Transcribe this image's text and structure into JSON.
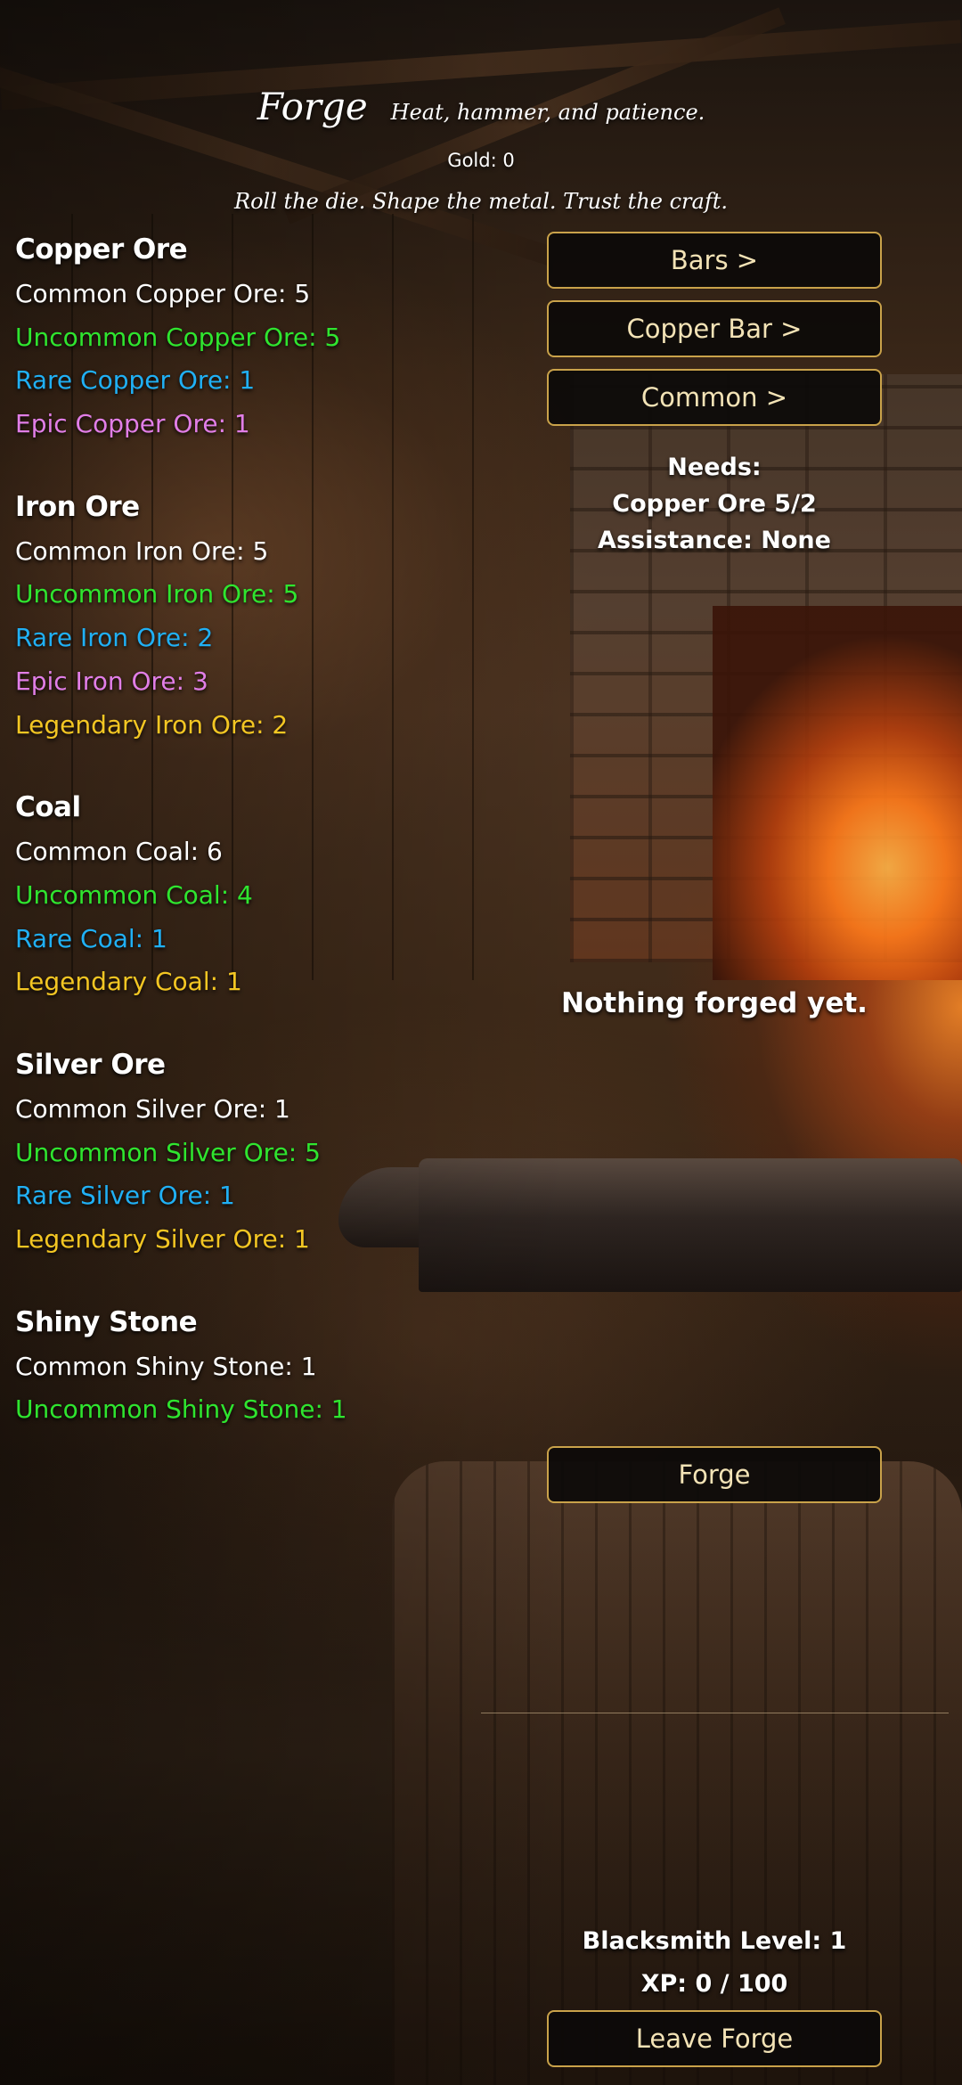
{
  "header": {
    "title": "Forge",
    "tagline": "Heat, hammer, and patience.",
    "gold": "Gold: 0",
    "motto": "Roll the die. Shape the metal. Trust the craft."
  },
  "inventory": {
    "copper": {
      "title": "Copper Ore",
      "items": [
        "Common Copper Ore: 5",
        "Uncommon Copper Ore: 5",
        "Rare Copper Ore: 1",
        "Epic Copper Ore: 1"
      ]
    },
    "iron": {
      "title": "Iron Ore",
      "items": [
        "Common Iron Ore: 5",
        "Uncommon Iron Ore: 5",
        "Rare Iron Ore: 2",
        "Epic Iron Ore: 3",
        "Legendary Iron Ore: 2"
      ]
    },
    "coal": {
      "title": "Coal",
      "items": [
        "Common Coal: 6",
        "Uncommon Coal: 4",
        "Rare Coal: 1",
        "Legendary Coal: 1"
      ]
    },
    "silver": {
      "title": "Silver Ore",
      "items": [
        "Common Silver Ore: 1",
        "Uncommon Silver Ore: 5",
        "Rare Silver Ore: 1",
        "Legendary Silver Ore: 1"
      ]
    },
    "shiny": {
      "title": "Shiny Stone",
      "items": [
        "Common Shiny Stone: 1",
        "Uncommon Shiny Stone: 1"
      ]
    }
  },
  "rarity_colors": {
    "common": "#ffffff",
    "uncommon": "#2fe52f",
    "rare": "#20b0f5",
    "epic": "#e17ee7",
    "legendary": "#f3c623"
  },
  "accent_color": "#c9a24a",
  "menu": {
    "category": "Bars >",
    "recipe": "Copper Bar >",
    "quality": "Common >"
  },
  "requirements": {
    "heading": "Needs:",
    "ore": "Copper Ore 5/2",
    "assistance": "Assistance: None"
  },
  "result": "Nothing forged yet.",
  "forge_button": "Forge",
  "stats": {
    "level": "Blacksmith Level: 1",
    "xp": "XP: 0 / 100"
  },
  "leave_button": "Leave Forge"
}
